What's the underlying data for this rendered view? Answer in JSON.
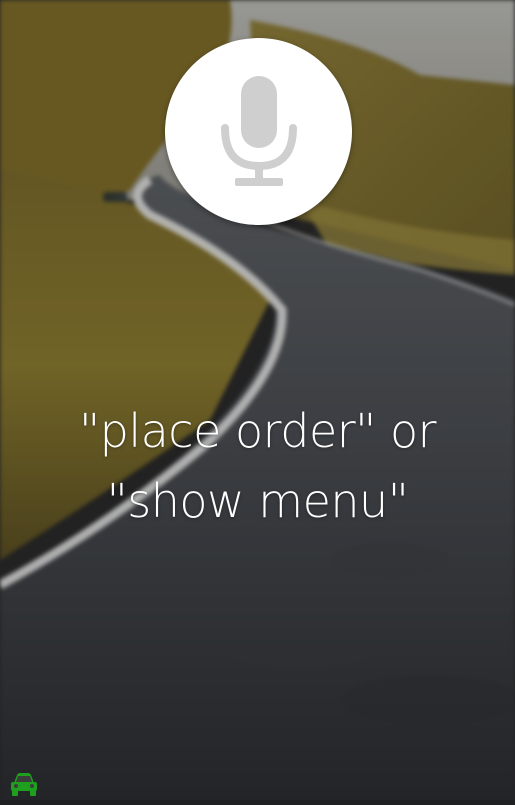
{
  "prompt": {
    "line1": "\"place order\" or",
    "line2": "\"show menu\""
  },
  "icons": {
    "mic": "microphone-icon",
    "car": "car-icon"
  },
  "colors": {
    "mic_button_bg": "#ffffff",
    "mic_icon": "#cfcfcf",
    "prompt_text": "#ffffff",
    "car_icon": "#1ea01e"
  }
}
